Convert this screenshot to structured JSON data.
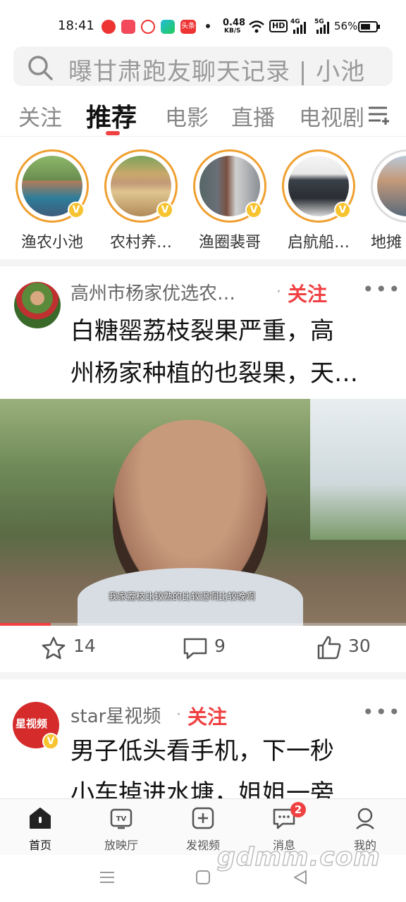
{
  "status_bar": {
    "time": "18:41",
    "net_speed_value": "0.48",
    "net_speed_unit": "KB/S",
    "hd_label": "HD",
    "sig1_label": "4G",
    "sig2_label": "5G",
    "battery": "56%",
    "toutiao_label": "头条"
  },
  "search": {
    "placeholder": "曝甘肃跑友聊天记录 | 小池"
  },
  "tabs": [
    "关注",
    "推荐",
    "电影",
    "直播",
    "电视剧"
  ],
  "stories": [
    {
      "name": "渔农小池"
    },
    {
      "name": "农村养…"
    },
    {
      "name": "渔圈裴哥"
    },
    {
      "name": "启航船…"
    },
    {
      "name": "地摊"
    }
  ],
  "post1": {
    "author": "高州市杨家优选农…",
    "follow": "关注",
    "title_line1": "白糖罂荔枝裂果严重，高",
    "title_line2": "州杨家种植的也裂果，天…",
    "caption": "我家荔枝比较熟的比较迟啊比较晚啊",
    "progress": 0.125,
    "favorites": "14",
    "comments": "9",
    "likes": "30"
  },
  "post2": {
    "author": "star星视频",
    "follow": "关注",
    "title_line1": "男子低头看手机，下一秒",
    "title_line2": "小车掉进水塘，姐姐一旁",
    "avatar_text": "星视频"
  },
  "bottom_nav": [
    {
      "label": "首页"
    },
    {
      "label": "放映厅"
    },
    {
      "label": "发视频"
    },
    {
      "label": "消息",
      "badge": "2"
    },
    {
      "label": "我的"
    }
  ],
  "watermark": "gdmm.com",
  "colors": {
    "accent": "#f04142",
    "verified": "#f7c32e",
    "ring": "#f0a030"
  }
}
